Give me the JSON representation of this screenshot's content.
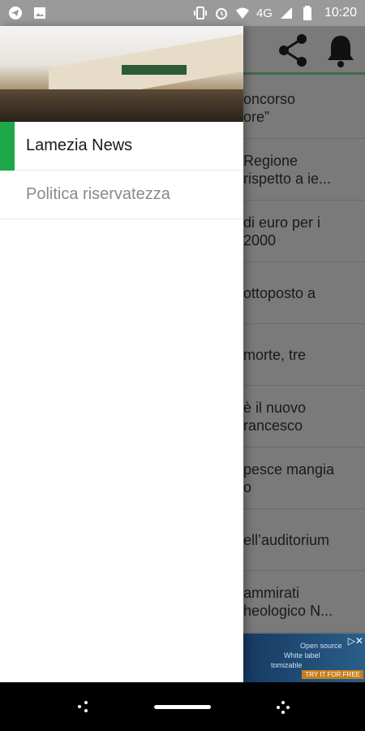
{
  "status_bar": {
    "time": "10:20",
    "network": "4G",
    "icons_left": [
      "telegram-icon",
      "image-icon"
    ],
    "icons_right": [
      "vibrate-icon",
      "alarm-icon",
      "wifi-icon",
      "signal-icon",
      "battery-icon"
    ]
  },
  "toolbar": {
    "share_icon": "share-icon",
    "bell_icon": "bell-icon",
    "accent": "#3d6b4a"
  },
  "news_items": [
    "oncorso\nore”",
    "Regione\n rispetto a ie...",
    "di euro per i\n 2000",
    "ottoposto a",
    "morte, tre",
    "è il nuovo\nrancesco",
    "pesce mangia\no",
    "ell’auditorium",
    "ammirati\nheologico N..."
  ],
  "ad": {
    "line1": "Open source",
    "line2": "White label",
    "line3": "tomizable",
    "cta": "TRY IT FOR FREE"
  },
  "drawer": {
    "items": [
      {
        "label": "Lamezia News",
        "active": true
      },
      {
        "label": "Politica riservatezza",
        "active": false
      }
    ],
    "accent": "#1ea84a"
  }
}
